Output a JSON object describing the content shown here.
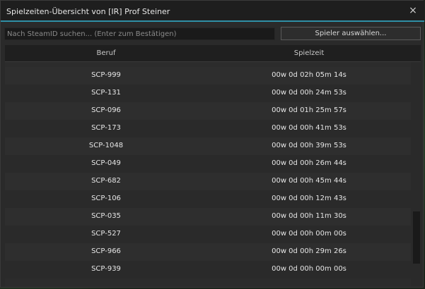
{
  "window": {
    "title": "Spielzeiten-Übersicht von [IR] Prof Steiner",
    "close_icon": "×"
  },
  "toolbar": {
    "search_placeholder": "Nach SteamID suchen... (Enter zum Bestätigen)",
    "select_player_label": "Spieler auswählen..."
  },
  "table": {
    "headers": {
      "job": "Beruf",
      "playtime": "Spielzeit"
    },
    "rows": [
      {
        "job": "SCP-999",
        "playtime": "00w 0d 02h 05m 14s"
      },
      {
        "job": "SCP-131",
        "playtime": "00w 0d 00h 24m 53s"
      },
      {
        "job": "SCP-096",
        "playtime": "00w 0d 01h 25m 57s"
      },
      {
        "job": "SCP-173",
        "playtime": "00w 0d 00h 41m 53s"
      },
      {
        "job": "SCP-1048",
        "playtime": "00w 0d 00h 39m 53s"
      },
      {
        "job": "SCP-049",
        "playtime": "00w 0d 00h 26m 44s"
      },
      {
        "job": "SCP-682",
        "playtime": "00w 0d 00h 45m 44s"
      },
      {
        "job": "SCP-106",
        "playtime": "00w 0d 00h 12m 43s"
      },
      {
        "job": "SCP-035",
        "playtime": "00w 0d 00h 11m 30s"
      },
      {
        "job": "SCP-527",
        "playtime": "00w 0d 00h 00m 00s"
      },
      {
        "job": "SCP-966",
        "playtime": "00w 0d 00h 29m 26s"
      },
      {
        "job": "SCP-939",
        "playtime": "00w 0d 00h 00m 00s"
      }
    ]
  },
  "colors": {
    "accent": "#2f8fa6",
    "panel": "#2a2a2a",
    "header": "#1f1f1f"
  }
}
